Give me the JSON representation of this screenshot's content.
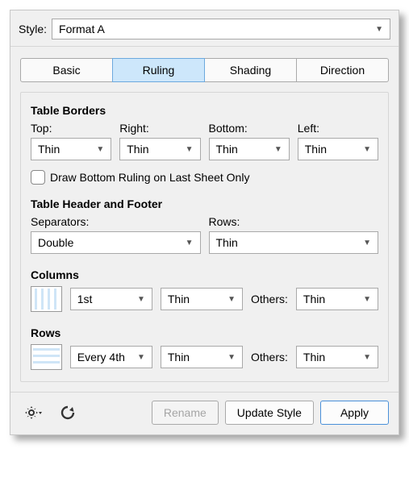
{
  "styleRow": {
    "label": "Style:",
    "value": "Format A"
  },
  "tabs": {
    "basic": "Basic",
    "ruling": "Ruling",
    "shading": "Shading",
    "direction": "Direction",
    "active": "ruling"
  },
  "tableBorders": {
    "title": "Table Borders",
    "top": {
      "label": "Top:",
      "value": "Thin"
    },
    "right": {
      "label": "Right:",
      "value": "Thin"
    },
    "bottom": {
      "label": "Bottom:",
      "value": "Thin"
    },
    "left": {
      "label": "Left:",
      "value": "Thin"
    },
    "drawBottomCheckbox": {
      "label": "Draw Bottom Ruling on Last Sheet Only",
      "checked": false
    }
  },
  "headerFooter": {
    "title": "Table Header and Footer",
    "separators": {
      "label": "Separators:",
      "value": "Double"
    },
    "rows": {
      "label": "Rows:",
      "value": "Thin"
    }
  },
  "columns": {
    "title": "Columns",
    "every": "1st",
    "style": "Thin",
    "othersLabel": "Others:",
    "othersValue": "Thin"
  },
  "rows": {
    "title": "Rows",
    "every": "Every 4th",
    "style": "Thin",
    "othersLabel": "Others:",
    "othersValue": "Thin"
  },
  "footer": {
    "rename": "Rename",
    "updateStyle": "Update Style",
    "apply": "Apply"
  }
}
